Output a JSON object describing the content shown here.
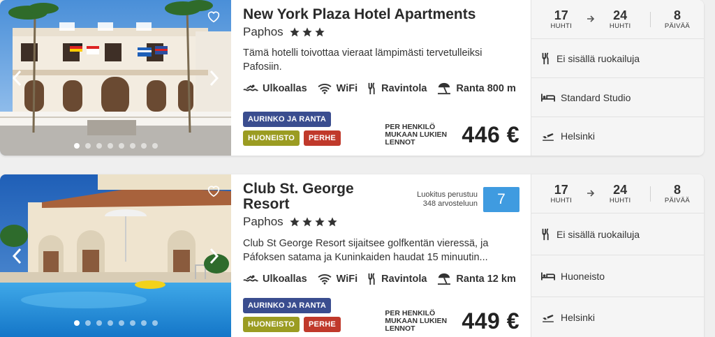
{
  "hotels": [
    {
      "name": "New York Plaza Hotel Apartments",
      "location": "Paphos",
      "stars": 3,
      "description": "Tämä hotelli toivottaa vieraat lämpimästi tervetulleiksi Pafosiin.",
      "amenities": [
        {
          "icon": "pool-icon",
          "label": "Ulkoallas"
        },
        {
          "icon": "wifi-icon",
          "label": "WiFi"
        },
        {
          "icon": "restaurant-icon",
          "label": "Ravintola"
        },
        {
          "icon": "beach-icon",
          "label": "Ranta 800 m"
        }
      ],
      "tags": {
        "row1": [
          "AURINKO JA RANTA"
        ],
        "row2": [
          "HUONEISTO",
          "PERHE"
        ]
      },
      "price_label": "PER HENKILÖ MUKAAN LUKIEN LENNOT",
      "price": "446 €",
      "rating": null,
      "dates": {
        "from_day": "17",
        "from_month": "HUHTI",
        "to_day": "24",
        "to_month": "HUHTI",
        "days": "8",
        "days_label": "PÄIVÄÄ"
      },
      "board": "Ei sisällä ruokailuja",
      "room": "Standard Studio",
      "departure": "Helsinki",
      "image_dots": 8
    },
    {
      "name": "Club St. George Resort",
      "location": "Paphos",
      "stars": 4,
      "description": "Club St George Resort sijaitsee golfkentän vieressä, ja Páfoksen satama ja Kuninkaiden haudat 15 minuutin...",
      "amenities": [
        {
          "icon": "pool-icon",
          "label": "Ulkoallas"
        },
        {
          "icon": "wifi-icon",
          "label": "WiFi"
        },
        {
          "icon": "restaurant-icon",
          "label": "Ravintola"
        },
        {
          "icon": "beach-icon",
          "label": "Ranta 12 km"
        }
      ],
      "tags": {
        "row1": [
          "AURINKO JA RANTA"
        ],
        "row2": [
          "HUONEISTO",
          "PERHE"
        ]
      },
      "price_label": "PER HENKILÖ MUKAAN LUKIEN LENNOT",
      "price": "449 €",
      "rating": {
        "text_line1": "Luokitus perustuu",
        "text_line2": "348 arvosteluun",
        "score": "7"
      },
      "dates": {
        "from_day": "17",
        "from_month": "HUHTI",
        "to_day": "24",
        "to_month": "HUHTI",
        "days": "8",
        "days_label": "PÄIVÄÄ"
      },
      "board": "Ei sisällä ruokailuja",
      "room": "Huoneisto",
      "departure": "Helsinki",
      "image_dots": 8
    }
  ],
  "colors": {
    "tag_blue": "#3a4d8f",
    "tag_olive": "#9b9c22",
    "tag_red": "#c0392b",
    "rating_blue": "#3f9be0"
  }
}
